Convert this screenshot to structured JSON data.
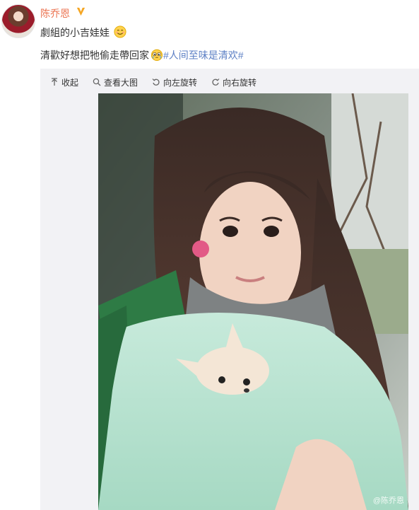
{
  "post": {
    "username": "陈乔恩",
    "text_line1": "劇組的小吉娃娃",
    "text_line2": "清歡好想把牠偷走帶回家",
    "hashtag": "#人间至味是清欢#"
  },
  "toolbar": {
    "collapse": "收起",
    "view_large": "查看大图",
    "rotate_left": "向左旋转",
    "rotate_right": "向右旋转"
  },
  "photo": {
    "watermark": "@陈乔恩"
  },
  "colors": {
    "username": "#eb7350",
    "hashtag": "#5d80c5",
    "verify_badge": "#f5a623",
    "media_bg": "#f2f2f5"
  },
  "icons": [
    "verified-badge-icon",
    "smile-emoji-icon",
    "tearful-emoji-icon",
    "collapse-arrow-icon",
    "magnifier-icon",
    "rotate-left-icon",
    "rotate-right-icon"
  ]
}
